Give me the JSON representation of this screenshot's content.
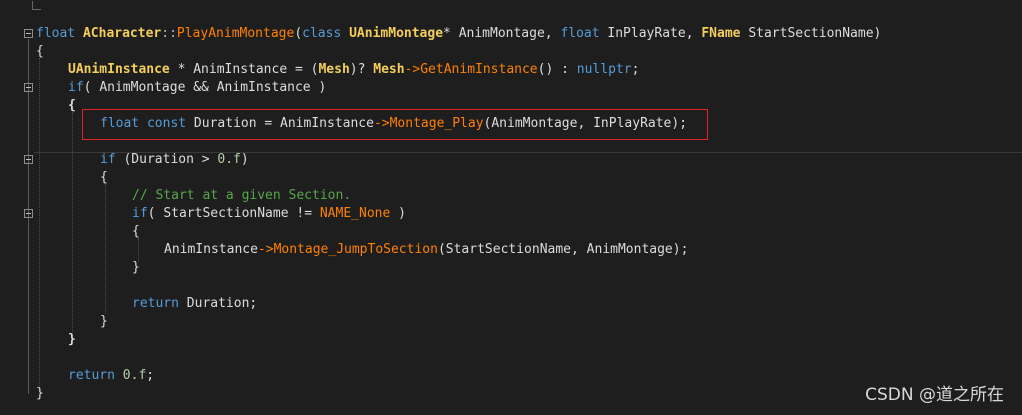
{
  "code": {
    "l1": {
      "kw_float": "float",
      "cls": "ACharacter",
      "scope": "::",
      "fn": "PlayAnimMontage",
      "paren_open": "(",
      "kw_class": "class",
      "type_montage": "UAnimMontage",
      "ptr": "* ",
      "p1": "AnimMontage",
      "comma1": ", ",
      "kw_float2": "float",
      "p2": "InPlayRate",
      "comma2": ", ",
      "type_fname": "FName",
      "p3": "StartSectionName",
      "paren_close": ")"
    },
    "l2": "{",
    "l3": {
      "type": "UAnimInstance",
      "rest1": " * AnimInstance = (",
      "mesh1": "Mesh",
      "rest2": ")? ",
      "mesh2": "Mesh",
      "arrow": "->",
      "fn": "GetAnimInstance",
      "rest3": "() : ",
      "nullptr": "nullptr",
      "semi": ";"
    },
    "l4": {
      "kw_if": "if",
      "open": "( ",
      "p1": "AnimMontage",
      "and": " && ",
      "p2": "AnimInstance",
      "close": " )"
    },
    "l5": "{",
    "l6": {
      "kw_float": "float",
      "kw_const": " const",
      "rest": " Duration = AnimInstance",
      "arrow": "->",
      "fn": "Montage_Play",
      "args": "(AnimMontage, InPlayRate);"
    },
    "l7": {
      "kw_if": "if",
      "rest": " (Duration > ",
      "num": "0.f",
      "close": ")"
    },
    "l8": "{",
    "l9": "// Start at a given Section.",
    "l10": {
      "kw_if": "if",
      "open": "( ",
      "p": "StartSectionName",
      "op": " != ",
      "enm": "NAME_None",
      "close": " )"
    },
    "l11": "{",
    "l12": {
      "obj": "AnimInstance",
      "arrow": "->",
      "fn": "Montage_JumpToSection",
      "args": "(StartSectionName, AnimMontage);"
    },
    "l13": "}",
    "l14": {
      "kw_return": "return",
      "rest": " Duration;"
    },
    "l15": "}",
    "l16": "}",
    "l17": {
      "kw_return": "return",
      "num": " 0.f",
      "semi": ";"
    },
    "l18": "}"
  },
  "watermark": "CSDN @道之所在",
  "colors": {
    "background": "#1e1e1e",
    "keyword": "#569cd6",
    "class": "#f3ce5b",
    "function_highlight": "#ff8000",
    "comment": "#57a64a",
    "highlight_box": "#e02424"
  }
}
